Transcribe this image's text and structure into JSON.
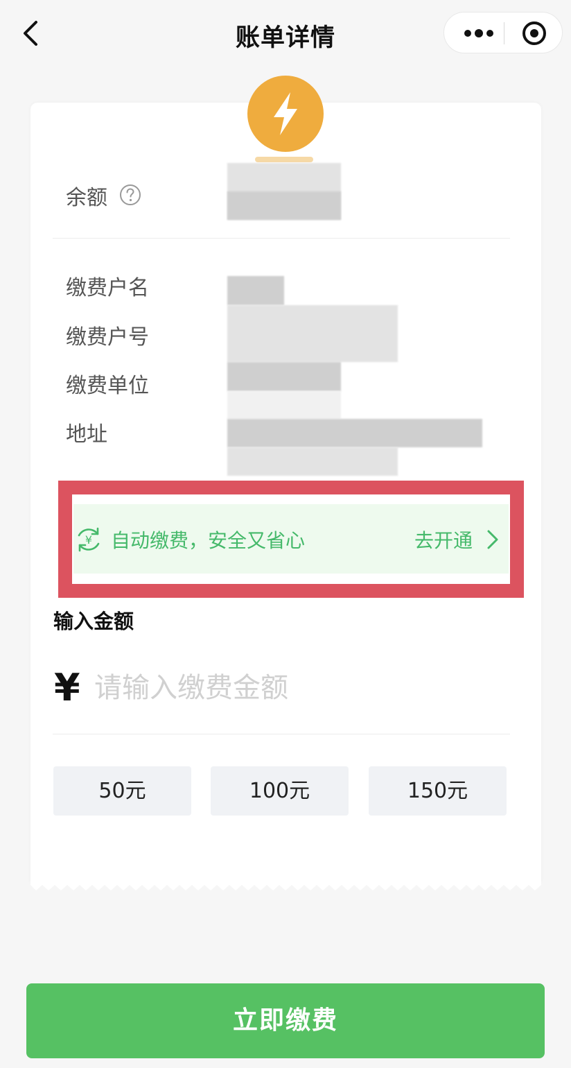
{
  "nav": {
    "title": "账单详情",
    "back_icon": "chevron-left-icon",
    "more_icon": "more-dots-icon",
    "close_icon": "record-target-icon"
  },
  "balance": {
    "label": "余额",
    "help_icon": "question-circle-icon"
  },
  "bill_info": {
    "fields": [
      {
        "label": "缴费户名"
      },
      {
        "label": "缴费户号"
      },
      {
        "label": "缴费单位"
      },
      {
        "label": "地址"
      }
    ]
  },
  "auto_pay": {
    "icon": "yen-refresh-icon",
    "text": "自动缴费，安全又省心",
    "link": "去开通"
  },
  "amount": {
    "title": "输入金额",
    "currency": "¥",
    "placeholder": "请输入缴费金额",
    "value": "",
    "quick_options": [
      "50元",
      "100元",
      "150元"
    ]
  },
  "submit": {
    "label": "立即缴费"
  },
  "colors": {
    "brand_green": "#56c163",
    "link_green": "#45b96a",
    "highlight_red": "#dc535f",
    "bolt_orange": "#efac3e"
  }
}
